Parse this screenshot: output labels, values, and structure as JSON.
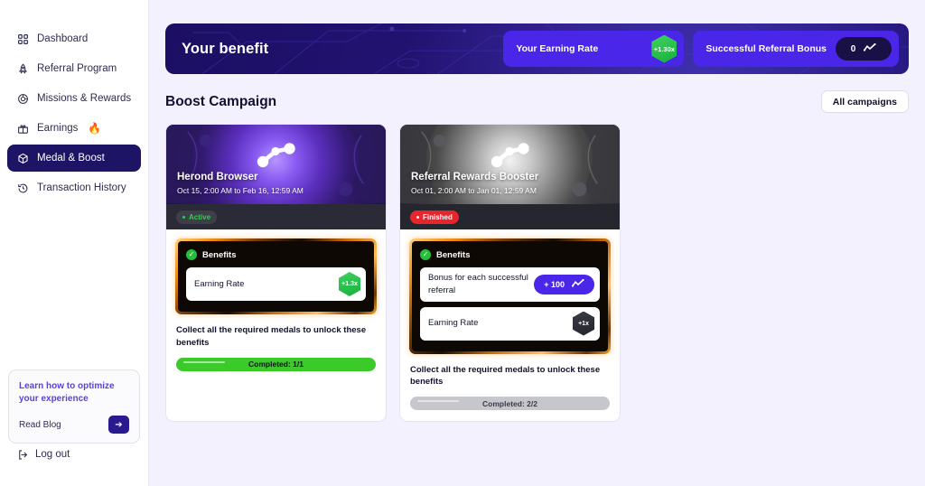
{
  "sidebar": {
    "items": [
      {
        "label": "Dashboard",
        "icon": "grid-icon",
        "active": false
      },
      {
        "label": "Referral Program",
        "icon": "rocket-icon",
        "active": false
      },
      {
        "label": "Missions & Rewards",
        "icon": "target-icon",
        "active": false
      },
      {
        "label": "Earnings",
        "icon": "gift-icon",
        "active": false,
        "suffix": "🔥"
      },
      {
        "label": "Medal & Boost",
        "icon": "box-icon",
        "active": true
      },
      {
        "label": "Transaction History",
        "icon": "history-icon",
        "active": false
      }
    ],
    "promo": {
      "title": "Learn how to optimize your experience",
      "link_label": "Read Blog",
      "button_icon": "arrow-right-icon"
    },
    "logout_label": "Log out",
    "logout_icon": "logout-icon"
  },
  "banner": {
    "title": "Your benefit",
    "cards": [
      {
        "label": "Your Earning Rate",
        "badge_type": "hex-green",
        "badge_value": "+1.30x"
      },
      {
        "label": "Successful Referral Bonus",
        "badge_type": "pill-dark",
        "badge_value": "0",
        "badge_icon": "sparkline-icon"
      }
    ]
  },
  "section": {
    "title": "Boost Campaign",
    "all_campaigns_label": "All campaigns"
  },
  "campaigns": [
    {
      "name": "Herond Browser",
      "date_range": "Oct 15, 2:00 AM to Feb 16, 12:59 AM",
      "status": "Active",
      "status_kind": "active",
      "theme": "purple",
      "benefits_label": "Benefits",
      "benefits": [
        {
          "label": "Earning Rate",
          "value": "+1.3x",
          "badge": "hex-green"
        }
      ],
      "footer_note": "Collect all the required medals to unlock these benefits",
      "progress_label": "Completed: 1/1",
      "progress_kind": "green",
      "progress_percent": 100
    },
    {
      "name": "Referral Rewards Booster",
      "date_range": "Oct 01, 2:00 AM to Jan 01, 12:59 AM",
      "status": "Finished",
      "status_kind": "finished",
      "theme": "gray",
      "benefits_label": "Benefits",
      "benefits": [
        {
          "label": "Bonus for each successful referral",
          "value": "+ 100",
          "badge": "pill-purple",
          "badge_icon": "sparkline-icon"
        },
        {
          "label": "Earning Rate",
          "value": "+1x",
          "badge": "hex-dark"
        }
      ],
      "footer_note": "Collect all the required medals to unlock these benefits",
      "progress_label": "Completed: 2/2",
      "progress_kind": "gray",
      "progress_percent": 100
    }
  ],
  "colors": {
    "accent_purple": "#4a26e8",
    "sidebar_active": "#1d1465",
    "banner_dark": "#1d1170",
    "green": "#24c03c",
    "red": "#e8252d",
    "page_bg": "#f2f1fd"
  }
}
